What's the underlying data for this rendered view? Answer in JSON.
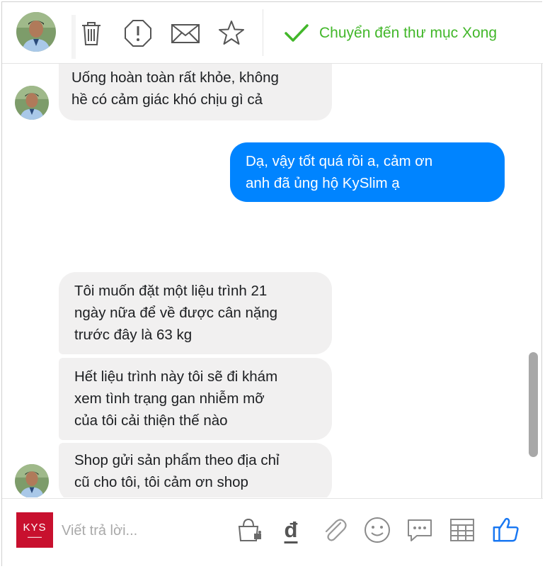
{
  "toolbar": {
    "done_label": "Chuyển đến thư mục Xong",
    "icons": [
      "trash-icon",
      "alert-icon",
      "mail-icon",
      "star-icon",
      "check-icon"
    ]
  },
  "messages": [
    {
      "direction": "incoming",
      "lines": [
        "Uống hoàn toàn rất khỏe, không",
        "hề có cảm giác khó chịu gì cả"
      ]
    },
    {
      "direction": "outgoing",
      "lines": [
        "Dạ, vậy tốt quá rồi a, cảm ơn",
        "anh đã ủng hộ KySlim ạ"
      ]
    },
    {
      "direction": "incoming",
      "lines": [
        "Tôi muốn đặt một liệu trình 21",
        "ngày nữa để về được cân nặng",
        "trước đây là 63 kg"
      ]
    },
    {
      "direction": "incoming",
      "lines": [
        "Hết liệu trình này tôi sẽ đi khám",
        "xem tình trạng gan nhiễm mỡ",
        "của tôi cải thiện thế nào"
      ]
    },
    {
      "direction": "incoming",
      "lines": [
        "Shop gửi sản phẩm theo địa chỉ",
        "cũ cho tôi, tôi cảm ơn shop"
      ]
    }
  ],
  "composer": {
    "brand_logo_text": "KYS",
    "placeholder": "Viết trả lời...",
    "currency_symbol": "đ",
    "icons": [
      "bag-icon",
      "currency-icon",
      "attachment-icon",
      "emoji-icon",
      "saved-reply-icon",
      "table-icon",
      "like-icon"
    ]
  },
  "colors": {
    "outgoing_bubble": "#0084ff",
    "incoming_bubble": "#f1f0f0",
    "done_green": "#42b72a",
    "like_blue": "#1877f2",
    "brand_red": "#c8102e"
  }
}
